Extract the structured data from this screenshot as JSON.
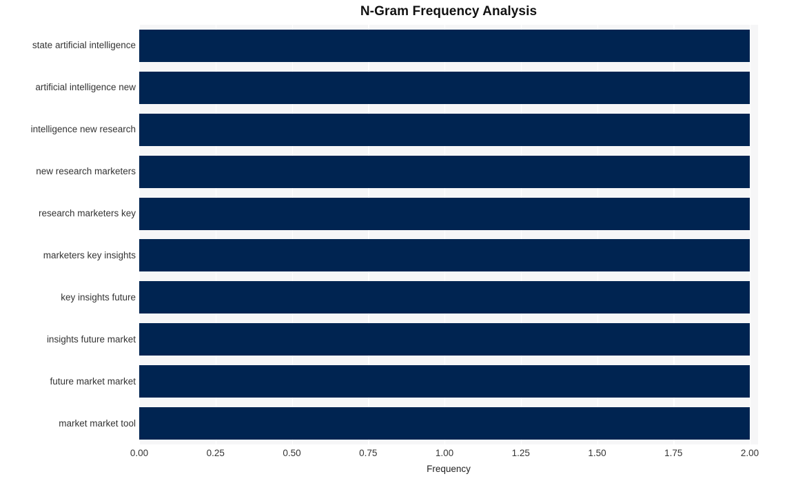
{
  "chart_data": {
    "type": "bar",
    "orientation": "horizontal",
    "title": "N-Gram Frequency Analysis",
    "xlabel": "Frequency",
    "ylabel": "",
    "categories": [
      "state artificial intelligence",
      "artificial intelligence new",
      "intelligence new research",
      "new research marketers",
      "research marketers key",
      "marketers key insights",
      "key insights future",
      "insights future market",
      "future market market",
      "market market tool"
    ],
    "values": [
      2,
      2,
      2,
      2,
      2,
      2,
      2,
      2,
      2,
      2
    ],
    "xlim": [
      0.0,
      2.0
    ],
    "xticks": [
      0.0,
      0.25,
      0.5,
      0.75,
      1.0,
      1.25,
      1.5,
      1.75,
      2.0
    ],
    "xtick_labels": [
      "0.00",
      "0.25",
      "0.50",
      "0.75",
      "1.00",
      "1.25",
      "1.50",
      "1.75",
      "2.00"
    ],
    "grid": true,
    "grid_axis": "x",
    "legend": null,
    "colors": {
      "bar": "#002451",
      "plot_background": "#f6f6f7",
      "figure_background": "#ffffff",
      "gridline": "#ffffff",
      "tick_label": "#333333",
      "title": "#111111"
    }
  }
}
